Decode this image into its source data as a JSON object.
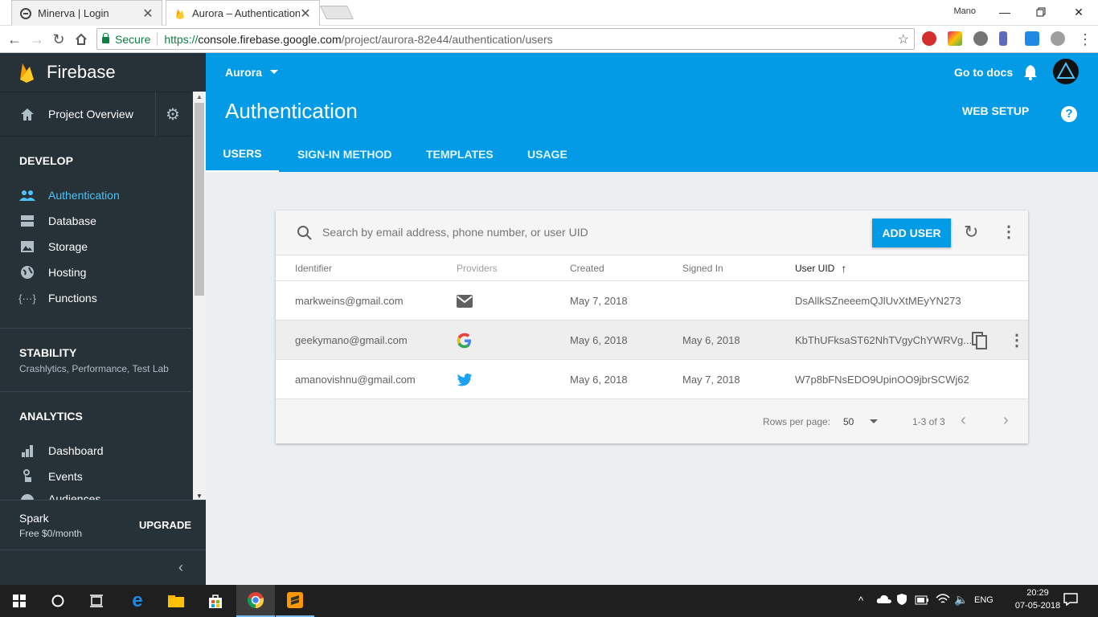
{
  "browser": {
    "tabs": [
      {
        "title": "Minerva | Login",
        "close": "✕"
      },
      {
        "title": "Aurora – Authentication -",
        "close": "✕"
      }
    ],
    "window_user": "Mano",
    "secure_label": "Secure",
    "url": {
      "scheme": "https://",
      "domain": "console.firebase.google.com",
      "path": "/project/aurora-82e44/authentication/users"
    }
  },
  "sidebar": {
    "brand": "Firebase",
    "project_overview": "Project Overview",
    "develop_heading": "DEVELOP",
    "develop_items": [
      {
        "label": "Authentication",
        "icon": "people-icon"
      },
      {
        "label": "Database",
        "icon": "database-icon"
      },
      {
        "label": "Storage",
        "icon": "image-icon"
      },
      {
        "label": "Hosting",
        "icon": "globe-icon"
      },
      {
        "label": "Functions",
        "icon": "functions-icon"
      }
    ],
    "stability_heading": "STABILITY",
    "stability_sub": "Crashlytics, Performance, Test Lab",
    "analytics_heading": "ANALYTICS",
    "analytics_items": [
      {
        "label": "Dashboard",
        "icon": "bar-chart-icon"
      },
      {
        "label": "Events",
        "icon": "touch-icon"
      },
      {
        "label": "Audiences",
        "icon": "globe-icon"
      }
    ],
    "plan_name": "Spark",
    "plan_price": "Free $0/month",
    "upgrade": "UPGRADE"
  },
  "header": {
    "project": "Aurora",
    "docs": "Go to docs",
    "title": "Authentication",
    "web_setup": "WEB SETUP",
    "tabs": [
      "USERS",
      "SIGN-IN METHOD",
      "TEMPLATES",
      "USAGE"
    ]
  },
  "users": {
    "search_placeholder": "Search by email address, phone number, or user UID",
    "add_user": "ADD USER",
    "columns": [
      "Identifier",
      "Providers",
      "Created",
      "Signed In",
      "User UID"
    ],
    "rows": [
      {
        "identifier": "markweins@gmail.com",
        "provider": "email",
        "created": "May 7, 2018",
        "signed_in": "",
        "uid": "DsAllkSZneeemQJlUvXtMEyYN273"
      },
      {
        "identifier": "geekymano@gmail.com",
        "provider": "google",
        "created": "May 6, 2018",
        "signed_in": "May 6, 2018",
        "uid": "KbThUFksaST62NhTVgyChYWRVg..."
      },
      {
        "identifier": "amanovishnu@gmail.com",
        "provider": "twitter",
        "created": "May 6, 2018",
        "signed_in": "May 7, 2018",
        "uid": "W7p8bFNsEDO9UpinOO9jbrSCWj62"
      }
    ],
    "rows_per_page_label": "Rows per page:",
    "rows_per_page": "50",
    "range": "1-3 of 3"
  },
  "taskbar": {
    "lang": "ENG",
    "time": "20:29",
    "date": "07-05-2018"
  },
  "colors": {
    "header_blue": "#039be5",
    "sidebar_dark": "#263238",
    "active_nav": "#4fc3f7"
  }
}
